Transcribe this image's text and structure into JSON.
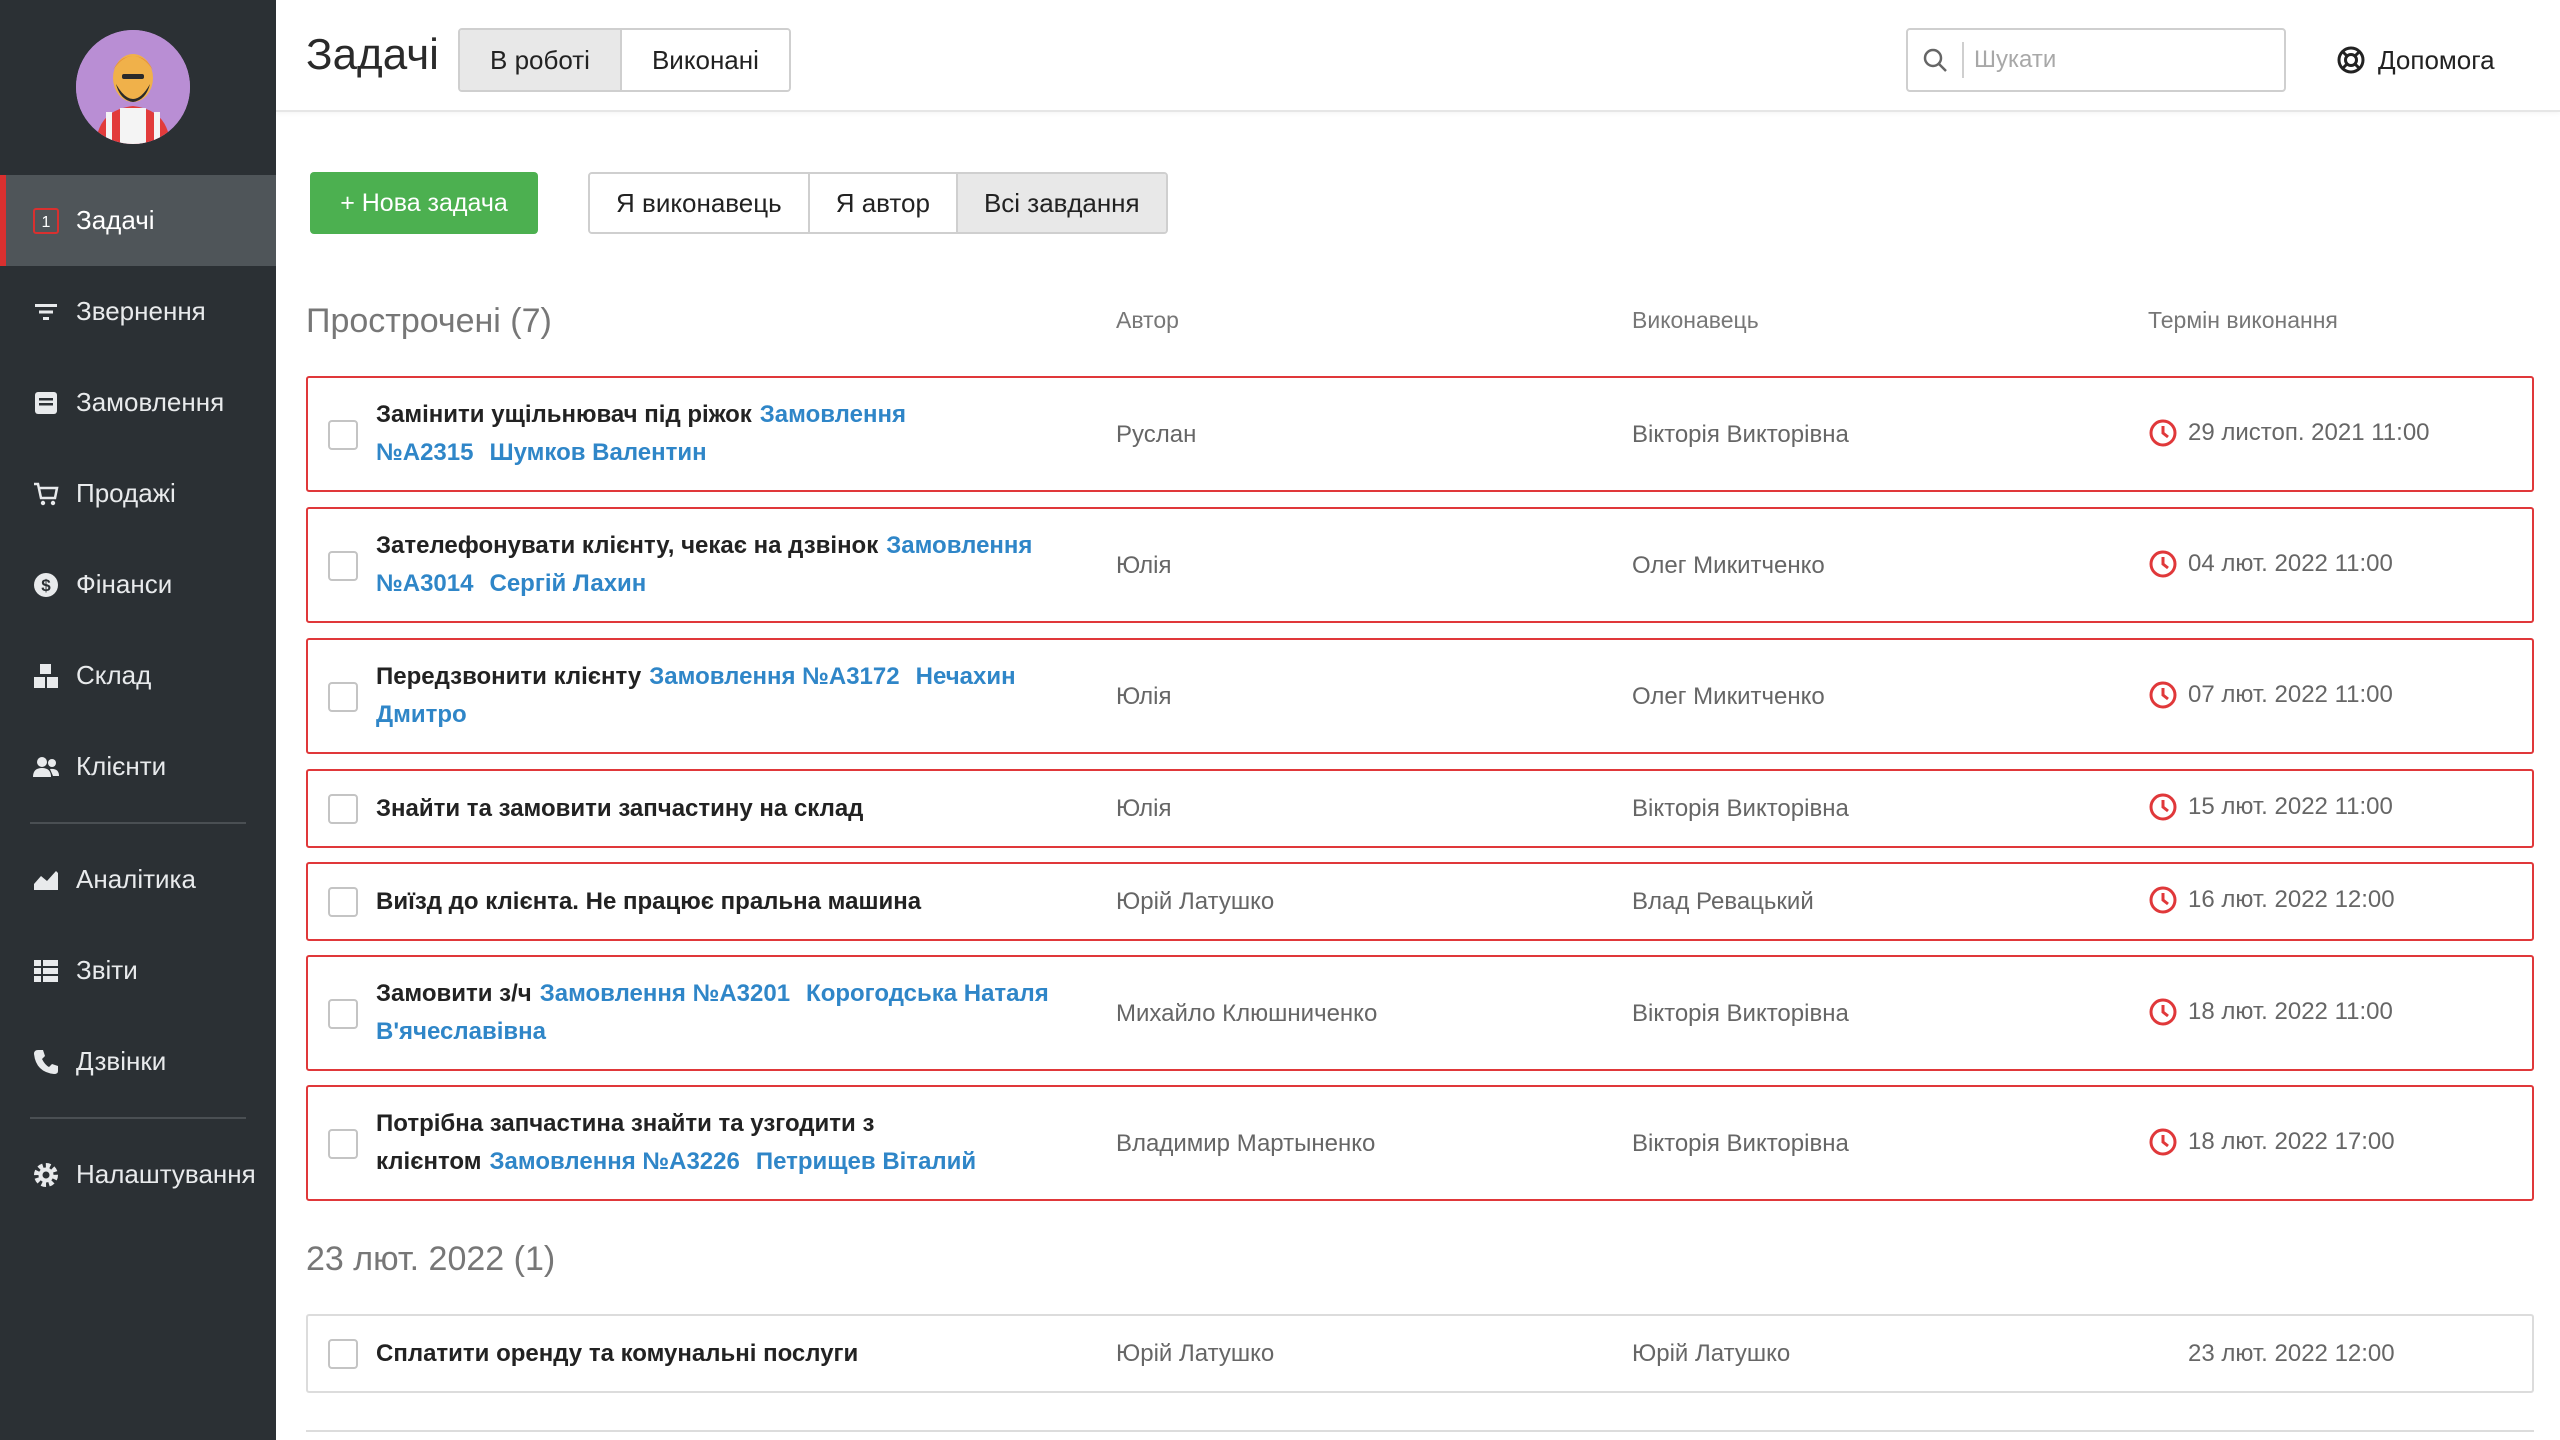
{
  "sidebar": {
    "items": [
      {
        "label": "Задачі",
        "icon": "tasks-icon",
        "badge": "1",
        "active": true
      },
      {
        "label": "Звернення",
        "icon": "filter-icon"
      },
      {
        "label": "Замовлення",
        "icon": "orders-icon"
      },
      {
        "label": "Продажі",
        "icon": "cart-icon"
      },
      {
        "label": "Фінанси",
        "icon": "dollar-icon"
      },
      {
        "label": "Склад",
        "icon": "boxes-icon"
      },
      {
        "label": "Клієнти",
        "icon": "users-icon"
      },
      {
        "label": "Аналітика",
        "icon": "chart-area-icon"
      },
      {
        "label": "Звіти",
        "icon": "table-icon"
      },
      {
        "label": "Дзвінки",
        "icon": "phone-icon"
      },
      {
        "label": "Налаштування",
        "icon": "gear-icon"
      }
    ]
  },
  "header": {
    "title": "Задачі",
    "tabs": [
      {
        "label": "В роботі",
        "active": true
      },
      {
        "label": "Виконані",
        "active": false
      }
    ],
    "search_placeholder": "Шукати",
    "help_label": "Допомога"
  },
  "toolbar": {
    "new_task_label": "+ Нова задача",
    "filters": [
      {
        "label": "Я виконавець",
        "active": false
      },
      {
        "label": "Я автор",
        "active": false
      },
      {
        "label": "Всі завдання",
        "active": true
      }
    ]
  },
  "columns": {
    "author": "Автор",
    "assignee": "Виконавець",
    "due": "Термін виконання"
  },
  "sections": [
    {
      "title": "Прострочені (7)",
      "tasks": [
        {
          "title": "Замінити ущільнювач під ріжок",
          "order": "Замовлення №А2315",
          "client": "Шумков Валентин",
          "author": "Руслан",
          "assignee": "Вікторія Викторівна",
          "due": "29 листоп. 2021 11:00"
        },
        {
          "title": "Зателефонувати клієнту, чекає на дзвінок",
          "order": "Замовлення №А3014",
          "client": "Сергій Лахин",
          "author": "Юлія",
          "assignee": "Олег Микитченко",
          "due": "04 лют. 2022 11:00"
        },
        {
          "title": "Передзвонити клієнту",
          "order": "Замовлення №А3172",
          "client": "Нечахин Дмитро",
          "author": "Юлія",
          "assignee": "Олег Микитченко",
          "due": "07 лют. 2022 11:00"
        },
        {
          "title": "Знайти та замовити запчастину на склад",
          "order": "",
          "client": "",
          "author": "Юлія",
          "assignee": "Вікторія Викторівна",
          "due": "15 лют. 2022 11:00"
        },
        {
          "title": "Виїзд до клієнта. Не працює пральна машина",
          "order": "",
          "client": "",
          "author": "Юрій Латушко",
          "assignee": "Влад Ревацький",
          "due": "16 лют. 2022 12:00"
        },
        {
          "title": "Замовити з/ч",
          "order": "Замовлення №А3201",
          "client": "Корогодська Наталя В'ячеславівна",
          "author": "Михайло Клюшниченко",
          "assignee": "Вікторія Викторівна",
          "due": "18 лют. 2022 11:00"
        },
        {
          "title": "Потрібна запчастина знайти та узгодити з клієнтом",
          "order": "Замовлення №А3226",
          "client": "Петрищев Віталий",
          "author": "Владимир Мартыненко",
          "assignee": "Вікторія Викторівна",
          "due": "18 лют. 2022 17:00"
        }
      ]
    },
    {
      "title": "23 лют. 2022 (1)",
      "tasks": [
        {
          "title": "Сплатити оренду та комунальні послуги",
          "order": "",
          "client": "",
          "author": "Юрій Латушко",
          "assignee": "Юрій Латушко",
          "due": "23 лют. 2022 12:00"
        }
      ]
    }
  ],
  "colors": {
    "sidebar_bg": "#2b3034",
    "active_accent": "#d9302f",
    "primary_green": "#4cb050",
    "link_blue": "#2f86c8",
    "overdue_red": "#e0383a"
  }
}
